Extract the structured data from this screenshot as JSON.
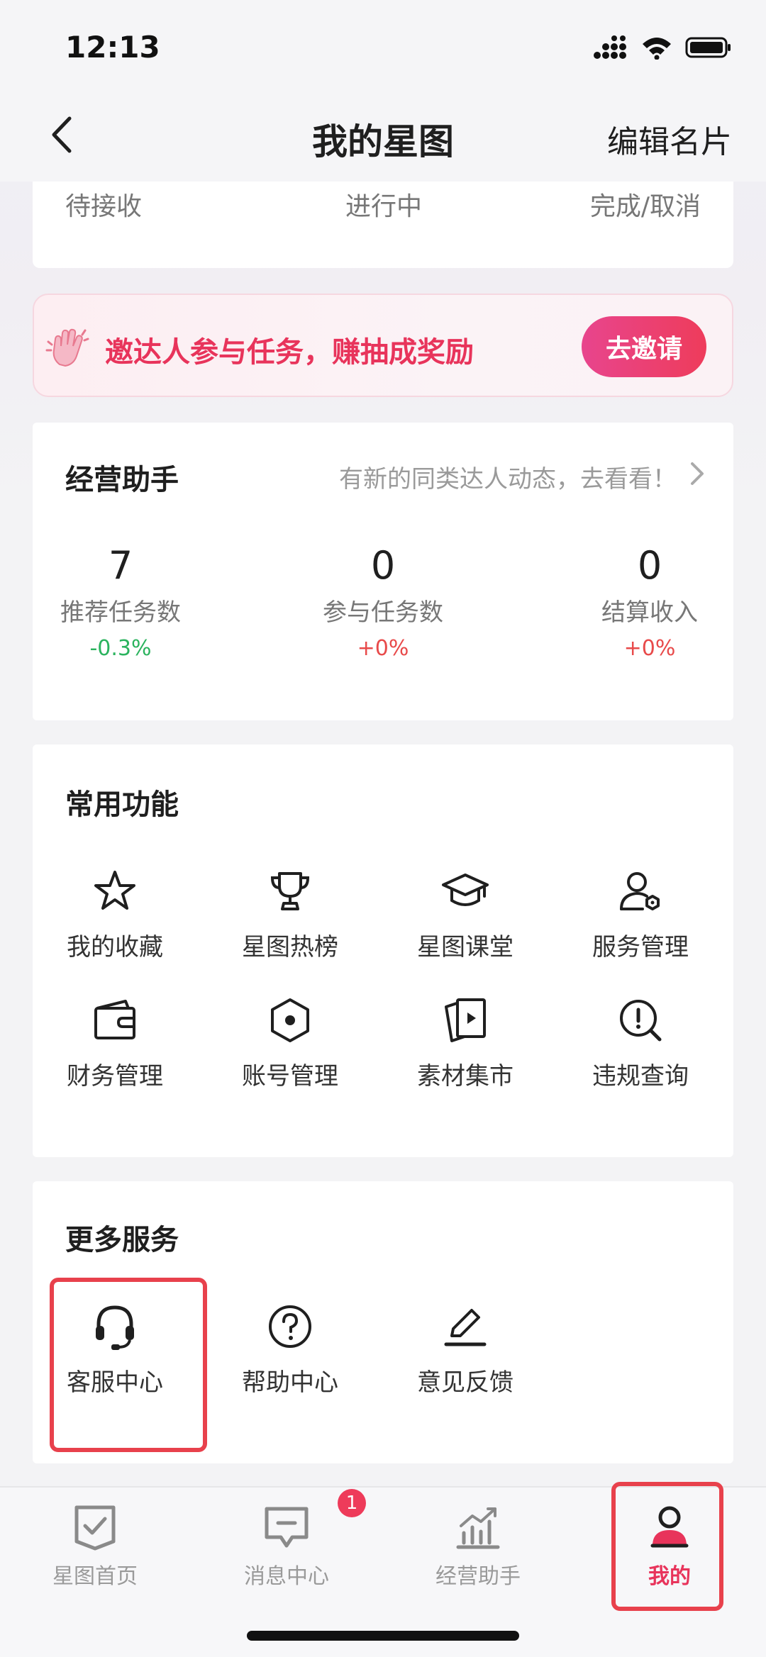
{
  "status_bar": {
    "time": "12:13"
  },
  "nav": {
    "title": "我的星图",
    "edit_label": "编辑名片"
  },
  "orders": {
    "tabs": [
      "待接收",
      "进行中",
      "完成/取消"
    ]
  },
  "invite": {
    "text": "邀达人参与任务，赚抽成奖励",
    "button": "去邀请"
  },
  "assistant": {
    "title": "经营助手",
    "hint": "有新的同类达人动态，去看看！",
    "stats": [
      {
        "value": "7",
        "label": "推荐任务数",
        "change": "-0.3%"
      },
      {
        "value": "0",
        "label": "参与任务数",
        "change": "+0%"
      },
      {
        "value": "0",
        "label": "结算收入",
        "change": "+0%"
      }
    ]
  },
  "functions": {
    "title": "常用功能",
    "items": [
      {
        "label": "我的收藏",
        "icon": "star-icon"
      },
      {
        "label": "星图热榜",
        "icon": "trophy-icon"
      },
      {
        "label": "星图课堂",
        "icon": "graduation-cap-icon"
      },
      {
        "label": "服务管理",
        "icon": "user-settings-icon"
      },
      {
        "label": "财务管理",
        "icon": "wallet-icon"
      },
      {
        "label": "账号管理",
        "icon": "hexagon-settings-icon"
      },
      {
        "label": "素材集市",
        "icon": "media-cards-icon"
      },
      {
        "label": "违规查询",
        "icon": "alert-search-icon"
      }
    ]
  },
  "more": {
    "title": "更多服务",
    "items": [
      {
        "label": "客服中心",
        "icon": "headset-icon"
      },
      {
        "label": "帮助中心",
        "icon": "help-circle-icon"
      },
      {
        "label": "意见反馈",
        "icon": "edit-pen-icon"
      }
    ]
  },
  "tabbar": {
    "items": [
      {
        "label": "星图首页",
        "icon": "home-shield-icon"
      },
      {
        "label": "消息中心",
        "icon": "message-icon"
      },
      {
        "label": "经营助手",
        "icon": "chart-icon"
      },
      {
        "label": "我的",
        "icon": "user-icon"
      }
    ],
    "message_badge": "1",
    "active": "我的"
  },
  "colors": {
    "accent": "#e8345b",
    "highlight": "#e8414c",
    "positive": "#2bb35e",
    "negative": "#e84a4a"
  }
}
